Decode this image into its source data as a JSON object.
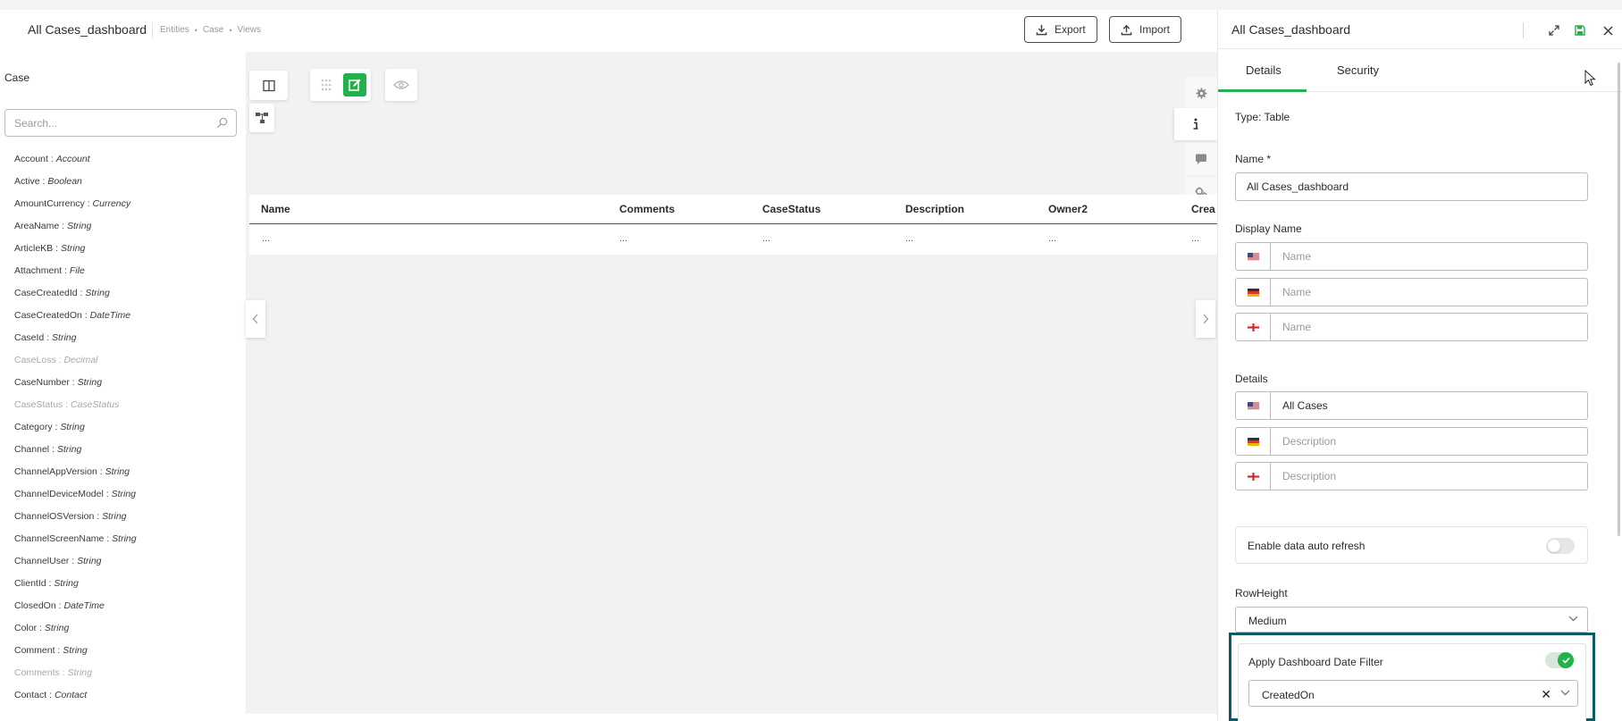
{
  "header": {
    "title": "All Cases_dashboard",
    "breadcrumb": [
      "Entities",
      "Case",
      "Views"
    ],
    "export_label": "Export",
    "import_label": "Import"
  },
  "sidebar": {
    "title": "Case",
    "search_placeholder": "Search...",
    "fields": [
      {
        "name": "Account",
        "type": "Account",
        "muted": false
      },
      {
        "name": "Active",
        "type": "Boolean",
        "muted": false
      },
      {
        "name": "AmountCurrency",
        "type": "Currency",
        "muted": false
      },
      {
        "name": "AreaName",
        "type": "String",
        "muted": false
      },
      {
        "name": "ArticleKB",
        "type": "String",
        "muted": false
      },
      {
        "name": "Attachment",
        "type": "File",
        "muted": false
      },
      {
        "name": "CaseCreatedId",
        "type": "String",
        "muted": false
      },
      {
        "name": "CaseCreatedOn",
        "type": "DateTime",
        "muted": false
      },
      {
        "name": "CaseId",
        "type": "String",
        "muted": false
      },
      {
        "name": "CaseLoss",
        "type": "Decimal",
        "muted": true
      },
      {
        "name": "CaseNumber",
        "type": "String",
        "muted": false
      },
      {
        "name": "CaseStatus",
        "type": "CaseStatus",
        "muted": true
      },
      {
        "name": "Category",
        "type": "String",
        "muted": false
      },
      {
        "name": "Channel",
        "type": "String",
        "muted": false
      },
      {
        "name": "ChannelAppVersion",
        "type": "String",
        "muted": false
      },
      {
        "name": "ChannelDeviceModel",
        "type": "String",
        "muted": false
      },
      {
        "name": "ChannelOSVersion",
        "type": "String",
        "muted": false
      },
      {
        "name": "ChannelScreenName",
        "type": "String",
        "muted": false
      },
      {
        "name": "ChannelUser",
        "type": "String",
        "muted": false
      },
      {
        "name": "ClientId",
        "type": "String",
        "muted": false
      },
      {
        "name": "ClosedOn",
        "type": "DateTime",
        "muted": false
      },
      {
        "name": "Color",
        "type": "String",
        "muted": false
      },
      {
        "name": "Comment",
        "type": "String",
        "muted": false
      },
      {
        "name": "Comments",
        "type": "String",
        "muted": true
      },
      {
        "name": "Contact",
        "type": "Contact",
        "muted": false
      }
    ]
  },
  "table": {
    "columns": [
      "Name",
      "Comments",
      "CaseStatus",
      "Description",
      "Owner2",
      "Crea"
    ],
    "row": [
      "...",
      "...",
      "...",
      "...",
      "...",
      "..."
    ]
  },
  "panel": {
    "title": "All Cases_dashboard",
    "tabs": [
      "Details",
      "Security"
    ],
    "type_text": "Type: Table",
    "name_label": "Name *",
    "name_value": "All Cases_dashboard",
    "display_name_label": "Display Name",
    "display_name_placeholders": [
      "Name",
      "Name",
      "Name"
    ],
    "details_label": "Details",
    "details_values": [
      {
        "text": "All Cases",
        "placeholder": false
      },
      {
        "text": "Description",
        "placeholder": true
      },
      {
        "text": "Description",
        "placeholder": true
      }
    ],
    "auto_refresh_label": "Enable data auto refresh",
    "auto_refresh_enabled": false,
    "row_height_label": "RowHeight",
    "row_height_value": "Medium",
    "date_filter_label": "Apply Dashboard Date Filter",
    "date_filter_enabled": true,
    "date_filter_field": "CreatedOn"
  },
  "colors": {
    "accent": "#22b14c",
    "highlight_border": "#0c5a63"
  }
}
